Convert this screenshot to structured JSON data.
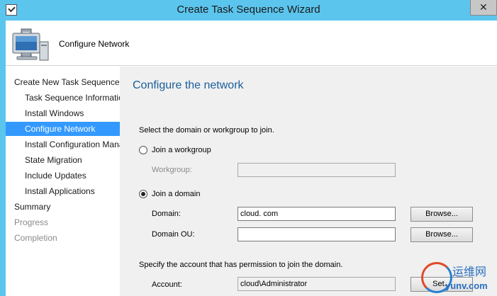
{
  "window": {
    "title": "Create Task Sequence Wizard"
  },
  "header": {
    "title": "Configure Network",
    "icon": "computer-icon"
  },
  "nav": {
    "items": [
      {
        "label": "Create New Task Sequence",
        "level": "top",
        "state": "normal"
      },
      {
        "label": "Task Sequence Information",
        "level": "sub",
        "state": "normal"
      },
      {
        "label": "Install Windows",
        "level": "sub",
        "state": "normal"
      },
      {
        "label": "Configure Network",
        "level": "sub",
        "state": "selected"
      },
      {
        "label": "Install Configuration Manager",
        "level": "sub",
        "state": "normal"
      },
      {
        "label": "State Migration",
        "level": "sub",
        "state": "normal"
      },
      {
        "label": "Include Updates",
        "level": "sub",
        "state": "normal"
      },
      {
        "label": "Install Applications",
        "level": "sub",
        "state": "normal"
      },
      {
        "label": "Summary",
        "level": "top",
        "state": "normal"
      },
      {
        "label": "Progress",
        "level": "top",
        "state": "disabled"
      },
      {
        "label": "Completion",
        "level": "top",
        "state": "disabled"
      }
    ]
  },
  "content": {
    "title": "Configure the network",
    "instruction": "Select the domain or workgroup to join.",
    "workgroup_option": {
      "label": "Join a workgroup",
      "checked": false
    },
    "workgroup_field": {
      "label": "Workgroup:",
      "value": "",
      "enabled": false
    },
    "domain_option": {
      "label": "Join a domain",
      "checked": true
    },
    "domain_field": {
      "label": "Domain:",
      "value": "cloud. com"
    },
    "domain_browse": "Browse...",
    "domain_ou_field": {
      "label": "Domain OU:",
      "value": ""
    },
    "domain_ou_browse": "Browse...",
    "account_instruction": "Specify the account that has permission to join the domain.",
    "account_field": {
      "label": "Account:",
      "value": "cloud\\Administrator"
    },
    "account_set": "Set..."
  },
  "watermark": {
    "text_cn": "运维网",
    "url": "yunv.com"
  },
  "colors": {
    "titlebar": "#5bc5ee",
    "selected": "#3399ff",
    "heading": "#1a5e9a"
  }
}
